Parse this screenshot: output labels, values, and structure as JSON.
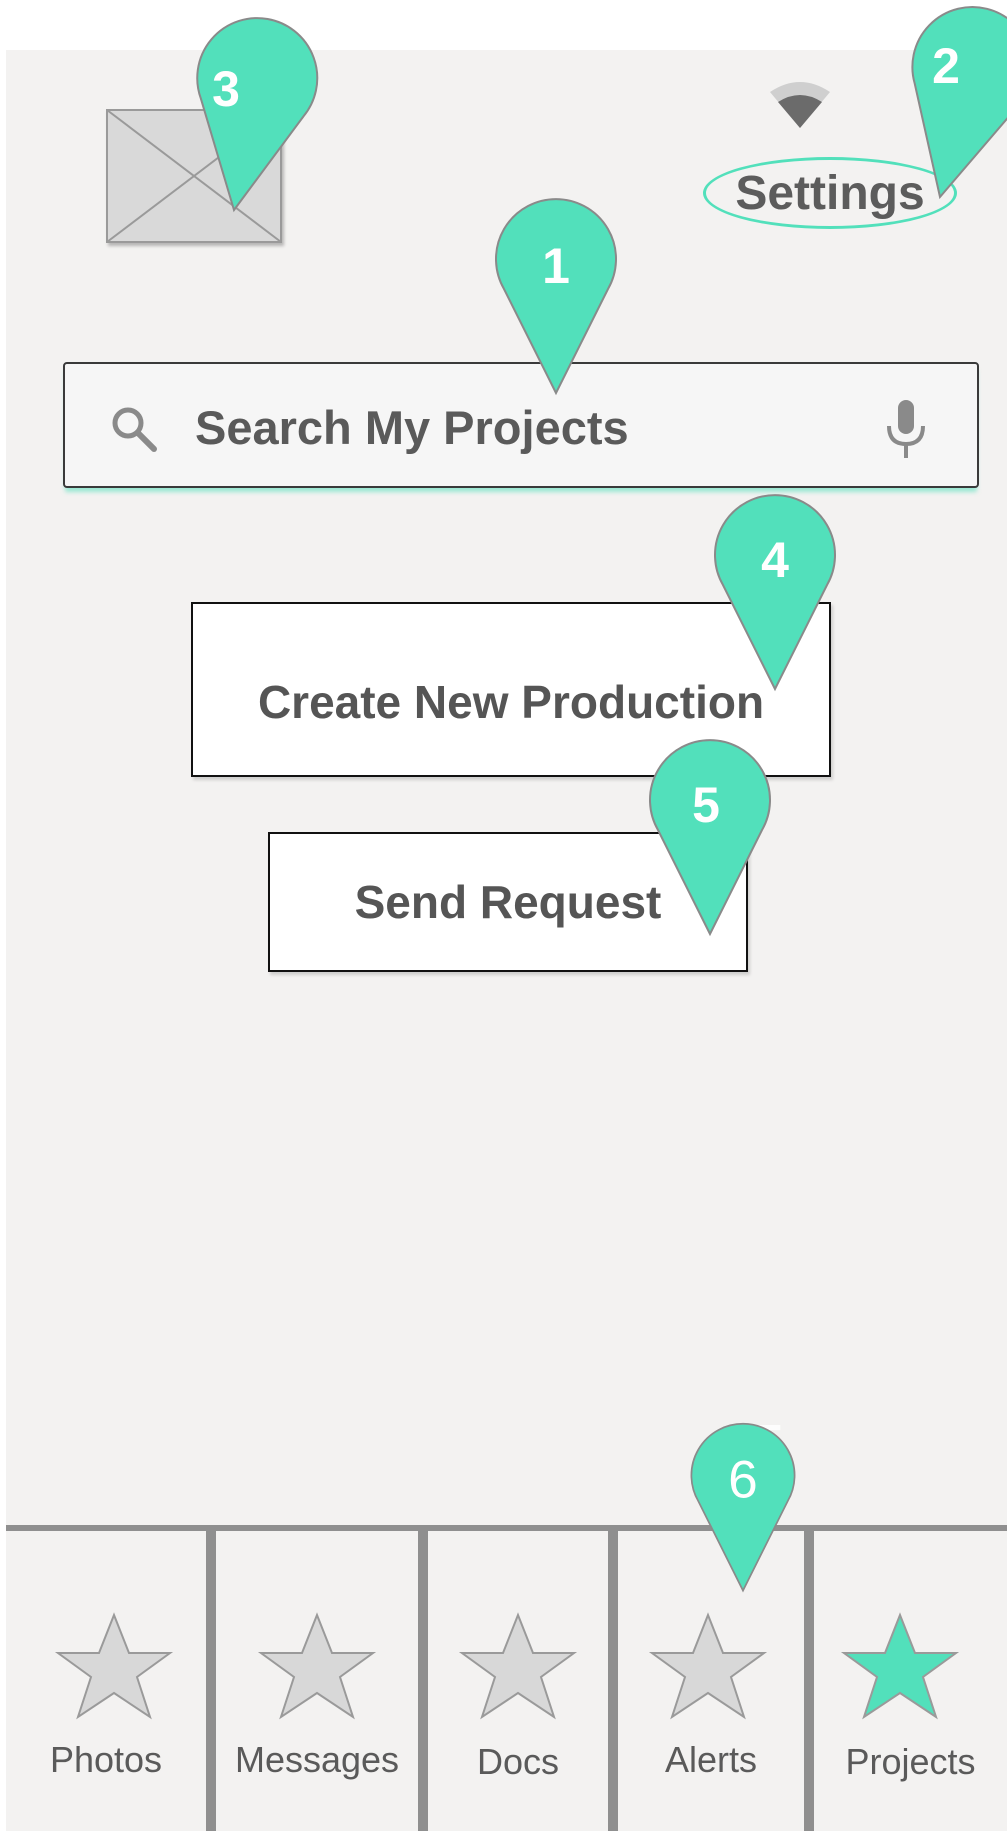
{
  "header": {
    "settings_label": "Settings"
  },
  "search": {
    "placeholder": "Search My Projects"
  },
  "actions": {
    "create_label": "Create New Production",
    "send_label": "Send Request"
  },
  "tabs": [
    {
      "label": "Photos",
      "icon": "star-icon",
      "active": false
    },
    {
      "label": "Messages",
      "icon": "star-icon",
      "active": false
    },
    {
      "label": "Docs",
      "icon": "star-icon",
      "active": false
    },
    {
      "label": "Alerts",
      "icon": "star-icon",
      "active": false
    },
    {
      "label": "Projects",
      "icon": "star-icon",
      "active": true
    }
  ],
  "annotations": {
    "pin1": "1",
    "pin2": "2",
    "pin3": "3",
    "pin4": "4",
    "pin5": "5",
    "pin6": "6",
    "ghost": "5"
  },
  "colors": {
    "accent": "#52e0bb",
    "background": "#f3f2f1",
    "text": "#5a5a5a",
    "inactive_star": "#d8d8d8"
  }
}
